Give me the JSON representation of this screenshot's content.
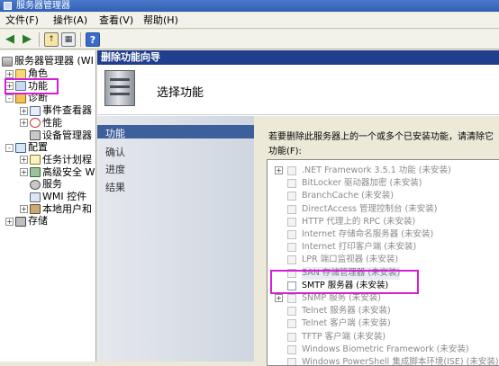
{
  "window": {
    "title": "服务器管理器"
  },
  "menu": [
    "文件(F)",
    "操作(A)",
    "查看(V)",
    "帮助(H)"
  ],
  "tree": {
    "root": "服务器管理器 (WI",
    "nodes": [
      {
        "label": "角色",
        "icon": "roles-icon",
        "level": 1,
        "exp": "+"
      },
      {
        "label": "功能",
        "icon": "features-icon",
        "level": 1,
        "exp": "+"
      },
      {
        "label": "诊断",
        "icon": "diagnostics-icon",
        "level": 1,
        "exp": "-"
      },
      {
        "label": "事件查看器",
        "icon": "event-viewer-icon",
        "level": 2,
        "exp": "+"
      },
      {
        "label": "性能",
        "icon": "performance-icon",
        "level": 2,
        "exp": "+"
      },
      {
        "label": "设备管理器",
        "icon": "device-manager-icon",
        "level": 2,
        "exp": ""
      },
      {
        "label": "配置",
        "icon": "configuration-icon",
        "level": 1,
        "exp": "-"
      },
      {
        "label": "任务计划程",
        "icon": "task-scheduler-icon",
        "level": 2,
        "exp": "+"
      },
      {
        "label": "高级安全 W",
        "icon": "firewall-icon",
        "level": 2,
        "exp": "+"
      },
      {
        "label": "服务",
        "icon": "services-icon",
        "level": 2,
        "exp": ""
      },
      {
        "label": "WMI 控件",
        "icon": "wmi-icon",
        "level": 2,
        "exp": ""
      },
      {
        "label": "本地用户和",
        "icon": "local-users-icon",
        "level": 2,
        "exp": "+"
      },
      {
        "label": "存储",
        "icon": "storage-icon",
        "level": 1,
        "exp": "+"
      }
    ]
  },
  "wizard": {
    "title": "删除功能向导",
    "heading": "选择功能",
    "steps": [
      "功能",
      "确认",
      "进度",
      "结果"
    ],
    "description": "若要删除此服务器上的一个或多个已安装功能，请清除它",
    "features_label": "功能(F):",
    "features": [
      {
        "label": ".NET Framework 3.5.1 功能  (未安装)",
        "exp": "+"
      },
      {
        "label": "BitLocker 驱动器加密  (未安装)",
        "exp": ""
      },
      {
        "label": "BranchCache  (未安装)",
        "exp": ""
      },
      {
        "label": "DirectAccess 管理控制台  (未安装)",
        "exp": ""
      },
      {
        "label": "HTTP 代理上的 RPC  (未安装)",
        "exp": ""
      },
      {
        "label": "Internet 存储命名服务器  (未安装)",
        "exp": ""
      },
      {
        "label": "Internet 打印客户端  (未安装)",
        "exp": ""
      },
      {
        "label": "LPR 端口监视器  (未安装)",
        "exp": ""
      },
      {
        "label": "SAN 存储管理器  (未安装)",
        "exp": ""
      },
      {
        "label": "SMTP 服务器  (未安装)",
        "exp": ""
      },
      {
        "label": "SNMP 服务  (未安装)",
        "exp": "+"
      },
      {
        "label": "Telnet 服务器  (未安装)",
        "exp": ""
      },
      {
        "label": "Telnet 客户端  (未安装)",
        "exp": ""
      },
      {
        "label": "TFTP 客户端  (未安装)",
        "exp": ""
      },
      {
        "label": "Windows Biometric Framework  (未安装)",
        "exp": ""
      },
      {
        "label": "Windows PowerShell 集成脚本环境(ISE)  (未安装)",
        "exp": ""
      }
    ]
  },
  "colors": {
    "highlight": "#d61ed6",
    "wizard_title_bg": "#1f3e8d",
    "nav_active_bg": "#3d5f9b"
  }
}
